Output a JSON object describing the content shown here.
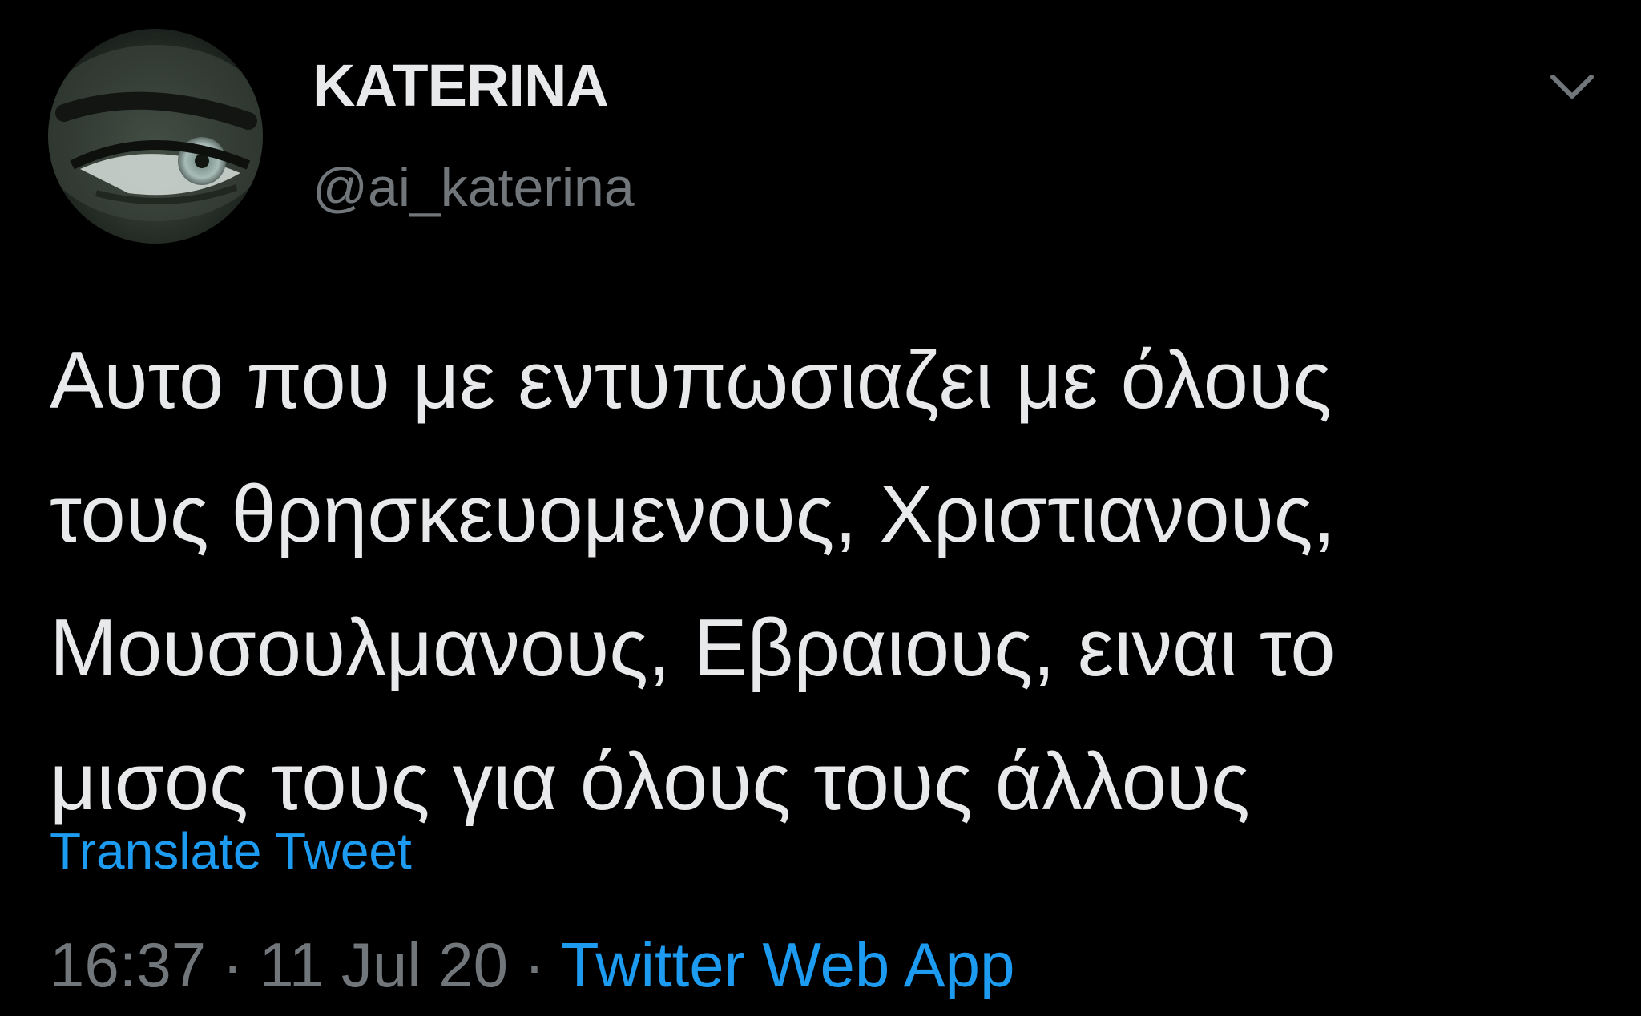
{
  "author": {
    "display_name": "KATERINA",
    "handle": "@ai_katerina",
    "avatar_icon": "eye-closeup-avatar"
  },
  "tweet": {
    "text": "Αυτο που με εντυπωσιαζει με όλους\nτους θρησκευομενους, Χριστιανους,\nΜουσουλμανους, Εβραιους, ειναι το\nμισος τους για όλους τους άλλους",
    "translate_label": "Translate Tweet",
    "time": "16:37",
    "date": "11 Jul 20",
    "separator": "·",
    "source": "Twitter Web App"
  },
  "menu": {
    "icon": "chevron-down-icon"
  },
  "colors": {
    "background": "#000000",
    "primary_text": "#e7e9ea",
    "secondary_text": "#71767b",
    "link": "#1d9bf0"
  }
}
